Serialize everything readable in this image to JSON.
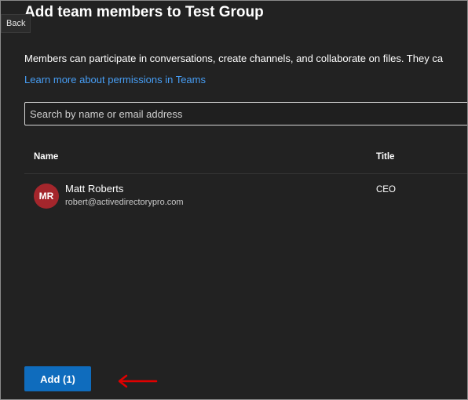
{
  "header": {
    "title": "Add team members to Test Group",
    "back_label": "Back"
  },
  "description": "Members can participate in conversations, create channels, and collaborate on files. They ca",
  "learn_more_link": "Learn more about permissions in Teams",
  "search": {
    "placeholder": "Search by name or email address",
    "value": ""
  },
  "table": {
    "columns": [
      "Name",
      "Title"
    ],
    "rows": [
      {
        "initials": "MR",
        "name": "Matt Roberts",
        "email": "robert@activedirectorypro.com",
        "title": "CEO",
        "avatar_color": "#a4262c"
      }
    ]
  },
  "add_button": {
    "label": "Add (1)"
  },
  "annotation_arrow": {
    "color": "#e00000"
  },
  "colors": {
    "background": "#222222",
    "accent": "#0f6cbd",
    "link": "#479ef5"
  }
}
